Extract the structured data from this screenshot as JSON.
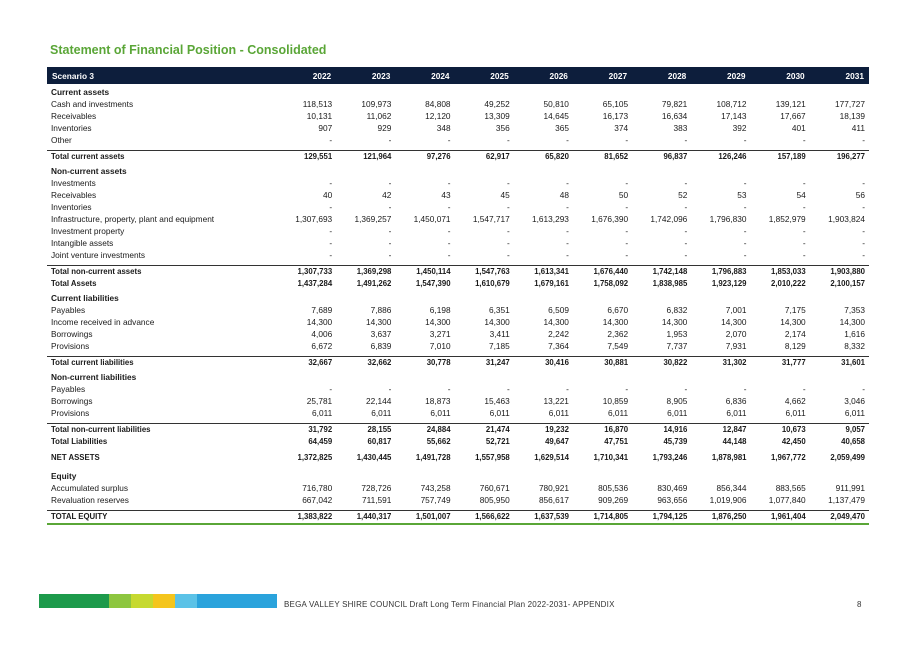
{
  "title": "Statement of Financial Position - Consolidated",
  "header": {
    "label": "Scenario 3",
    "years": [
      "2022",
      "2023",
      "2024",
      "2025",
      "2026",
      "2027",
      "2028",
      "2029",
      "2030",
      "2031"
    ]
  },
  "rows": [
    {
      "type": "section",
      "label": "Current assets"
    },
    {
      "type": "data",
      "label": "Cash and investments",
      "values": [
        "118,513",
        "109,973",
        "84,808",
        "49,252",
        "50,810",
        "65,105",
        "79,821",
        "108,712",
        "139,121",
        "177,727"
      ]
    },
    {
      "type": "data",
      "label": "Receivables",
      "values": [
        "10,131",
        "11,062",
        "12,120",
        "13,309",
        "14,645",
        "16,173",
        "16,634",
        "17,143",
        "17,667",
        "18,139"
      ]
    },
    {
      "type": "data",
      "label": "Inventories",
      "values": [
        "907",
        "929",
        "348",
        "356",
        "365",
        "374",
        "383",
        "392",
        "401",
        "411"
      ]
    },
    {
      "type": "data",
      "label": "Other",
      "values": [
        "-",
        "-",
        "-",
        "-",
        "-",
        "-",
        "-",
        "-",
        "-",
        "-"
      ]
    },
    {
      "type": "gap"
    },
    {
      "type": "total",
      "label": "Total current assets",
      "values": [
        "129,551",
        "121,964",
        "97,276",
        "62,917",
        "65,820",
        "81,652",
        "96,837",
        "126,246",
        "157,189",
        "196,277"
      ]
    },
    {
      "type": "section",
      "label": "Non-current assets"
    },
    {
      "type": "data",
      "label": "Investments",
      "values": [
        "-",
        "-",
        "-",
        "-",
        "-",
        "-",
        "-",
        "-",
        "-",
        "-"
      ]
    },
    {
      "type": "data",
      "label": "Receivables",
      "values": [
        "40",
        "42",
        "43",
        "45",
        "48",
        "50",
        "52",
        "53",
        "54",
        "56"
      ]
    },
    {
      "type": "data",
      "label": "Inventories",
      "values": [
        "-",
        "-",
        "-",
        "-",
        "-",
        "-",
        "-",
        "-",
        "-",
        "-"
      ]
    },
    {
      "type": "data",
      "label": "Infrastructure, property, plant and equipment",
      "values": [
        "1,307,693",
        "1,369,257",
        "1,450,071",
        "1,547,717",
        "1,613,293",
        "1,676,390",
        "1,742,096",
        "1,796,830",
        "1,852,979",
        "1,903,824"
      ]
    },
    {
      "type": "data",
      "label": "Investment property",
      "values": [
        "-",
        "-",
        "-",
        "-",
        "-",
        "-",
        "-",
        "-",
        "-",
        "-"
      ]
    },
    {
      "type": "data",
      "label": "Intangible assets",
      "values": [
        "-",
        "-",
        "-",
        "-",
        "-",
        "-",
        "-",
        "-",
        "-",
        "-"
      ]
    },
    {
      "type": "data",
      "label": "Joint venture investments",
      "values": [
        "-",
        "-",
        "-",
        "-",
        "-",
        "-",
        "-",
        "-",
        "-",
        "-"
      ]
    },
    {
      "type": "gap"
    },
    {
      "type": "total",
      "label": "Total non-current assets",
      "values": [
        "1,307,733",
        "1,369,298",
        "1,450,114",
        "1,547,763",
        "1,613,341",
        "1,676,440",
        "1,742,148",
        "1,796,883",
        "1,853,033",
        "1,903,880"
      ]
    },
    {
      "type": "total-nob",
      "label": "Total Assets",
      "values": [
        "1,437,284",
        "1,491,262",
        "1,547,390",
        "1,610,679",
        "1,679,161",
        "1,758,092",
        "1,838,985",
        "1,923,129",
        "2,010,222",
        "2,100,157"
      ]
    },
    {
      "type": "section",
      "label": "Current liabilities"
    },
    {
      "type": "data",
      "label": "Payables",
      "values": [
        "7,689",
        "7,886",
        "6,198",
        "6,351",
        "6,509",
        "6,670",
        "6,832",
        "7,001",
        "7,175",
        "7,353"
      ]
    },
    {
      "type": "data",
      "label": "Income received in advance",
      "values": [
        "14,300",
        "14,300",
        "14,300",
        "14,300",
        "14,300",
        "14,300",
        "14,300",
        "14,300",
        "14,300",
        "14,300"
      ]
    },
    {
      "type": "data",
      "label": "Borrowings",
      "values": [
        "4,006",
        "3,637",
        "3,271",
        "3,411",
        "2,242",
        "2,362",
        "1,953",
        "2,070",
        "2,174",
        "1,616"
      ]
    },
    {
      "type": "data",
      "label": "Provisions",
      "values": [
        "6,672",
        "6,839",
        "7,010",
        "7,185",
        "7,364",
        "7,549",
        "7,737",
        "7,931",
        "8,129",
        "8,332"
      ]
    },
    {
      "type": "gap"
    },
    {
      "type": "total",
      "label": "Total current liabilities",
      "values": [
        "32,667",
        "32,662",
        "30,778",
        "31,247",
        "30,416",
        "30,881",
        "30,822",
        "31,302",
        "31,777",
        "31,601"
      ]
    },
    {
      "type": "section",
      "label": "Non-current liabilities"
    },
    {
      "type": "data",
      "label": "Payables",
      "values": [
        "-",
        "-",
        "-",
        "-",
        "-",
        "-",
        "-",
        "-",
        "-",
        "-"
      ]
    },
    {
      "type": "data",
      "label": "Borrowings",
      "values": [
        "25,781",
        "22,144",
        "18,873",
        "15,463",
        "13,221",
        "10,859",
        "8,905",
        "6,836",
        "4,662",
        "3,046"
      ]
    },
    {
      "type": "data",
      "label": "Provisions",
      "values": [
        "6,011",
        "6,011",
        "6,011",
        "6,011",
        "6,011",
        "6,011",
        "6,011",
        "6,011",
        "6,011",
        "6,011"
      ]
    },
    {
      "type": "gap"
    },
    {
      "type": "total",
      "label": "Total non-current liabilities",
      "values": [
        "31,792",
        "28,155",
        "24,884",
        "21,474",
        "19,232",
        "16,870",
        "14,916",
        "12,847",
        "10,673",
        "9,057"
      ]
    },
    {
      "type": "total-nob",
      "label": "Total Liabilities",
      "values": [
        "64,459",
        "60,817",
        "55,662",
        "52,721",
        "49,647",
        "47,751",
        "45,739",
        "44,148",
        "42,450",
        "40,658"
      ]
    },
    {
      "type": "gap"
    },
    {
      "type": "total-nob",
      "label": "NET ASSETS",
      "values": [
        "1,372,825",
        "1,430,445",
        "1,491,728",
        "1,557,958",
        "1,629,514",
        "1,710,341",
        "1,793,246",
        "1,878,981",
        "1,967,772",
        "2,059,499"
      ]
    },
    {
      "type": "gap"
    },
    {
      "type": "section",
      "label": "Equity"
    },
    {
      "type": "data",
      "label": "Accumulated surplus",
      "values": [
        "716,780",
        "728,726",
        "743,258",
        "760,671",
        "780,921",
        "805,536",
        "830,469",
        "856,344",
        "883,565",
        "911,991"
      ]
    },
    {
      "type": "data",
      "label": "Revaluation reserves",
      "values": [
        "667,042",
        "711,591",
        "757,749",
        "805,950",
        "856,617",
        "909,269",
        "963,656",
        "1,019,906",
        "1,077,840",
        "1,137,479"
      ]
    },
    {
      "type": "gap"
    },
    {
      "type": "total-final",
      "label": "TOTAL EQUITY",
      "values": [
        "1,383,822",
        "1,440,317",
        "1,501,007",
        "1,566,622",
        "1,637,539",
        "1,714,805",
        "1,794,125",
        "1,876,250",
        "1,961,404",
        "2,049,470"
      ]
    }
  ],
  "footer": {
    "text": "BEGA VALLEY SHIRE COUNCIL  Draft Long Term Financial Plan 2022-2031- APPENDIX",
    "page": "8",
    "bar_colors": [
      "#1d9a4b",
      "#8dc63f",
      "#c6d930",
      "#f4c51d",
      "#5bc2e7",
      "#2aa3dc"
    ]
  }
}
